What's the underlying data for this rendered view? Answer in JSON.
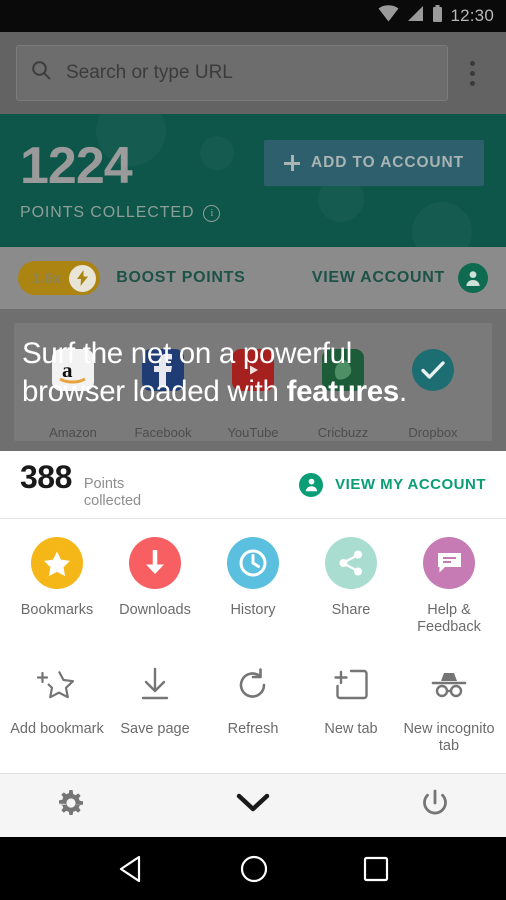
{
  "statusbar": {
    "time": "12:30",
    "icons": [
      "wifi-icon",
      "signal-icon",
      "battery-icon"
    ]
  },
  "toolbar": {
    "url_placeholder": "Search or type URL",
    "search_icon": "search-icon",
    "overflow_icon": "overflow-menu-icon"
  },
  "points_hero": {
    "points": "1224",
    "caption": "POINTS COLLECTED",
    "info_icon": "info-icon",
    "add_button": "ADD TO ACCOUNT",
    "add_icon": "plus-icon",
    "bg_color": "#0d5649",
    "button_color": "#2e5f6d"
  },
  "boost_row": {
    "multiplier": "1.6x",
    "bolt_icon": "lightning-bolt-icon",
    "label": "BOOST POINTS",
    "view_account": "VIEW ACCOUNT",
    "avatar_icon": "account-avatar-icon",
    "pill_color": "#ab8412"
  },
  "promo": {
    "line1": "Surf the net on a powerful",
    "line2_normal": "browser loaded with ",
    "line2_bold": "features",
    "line2_end": "."
  },
  "shortcuts": [
    {
      "label": "Amazon",
      "icon": "amazon-icon",
      "color": "#ffffff"
    },
    {
      "label": "Facebook",
      "icon": "facebook-icon",
      "color": "#1f3c75"
    },
    {
      "label": "YouTube",
      "icon": "youtube-icon",
      "color": "#a62020"
    },
    {
      "label": "Cricbuzz",
      "icon": "cricbuzz-icon",
      "color": "#1d5c38"
    },
    {
      "label": "Dropbox",
      "icon": "dropbox-check-icon",
      "color": "#1d6e72"
    }
  ],
  "sheet_points": {
    "number": "388",
    "caption_line1": "Points",
    "caption_line2": "collected",
    "view_account": "VIEW MY ACCOUNT",
    "avatar_icon": "account-avatar-icon",
    "accent_color": "#0a9d76"
  },
  "menu_row1": [
    {
      "label": "Bookmarks",
      "icon": "star-icon",
      "color": "#f5b618"
    },
    {
      "label": "Downloads",
      "icon": "download-arrow-icon",
      "color": "#f85f62"
    },
    {
      "label": "History",
      "icon": "clock-icon",
      "color": "#5bbfe0"
    },
    {
      "label": "Share",
      "icon": "share-icon",
      "color": "#a8ddd0"
    },
    {
      "label": "Help & Feedback",
      "icon": "chat-bubble-icon",
      "color": "#c77bb4"
    }
  ],
  "menu_row2": [
    {
      "label": "Add bookmark",
      "icon": "star-plus-icon"
    },
    {
      "label": "Save page",
      "icon": "save-download-icon"
    },
    {
      "label": "Refresh",
      "icon": "refresh-icon"
    },
    {
      "label": "New tab",
      "icon": "new-tab-icon"
    },
    {
      "label": "New incognito tab",
      "icon": "incognito-icon"
    }
  ],
  "sheet_bottom": [
    {
      "name": "settings",
      "icon": "gear-icon"
    },
    {
      "name": "collapse",
      "icon": "chevron-down-icon"
    },
    {
      "name": "exit",
      "icon": "power-icon"
    }
  ],
  "navbar": [
    {
      "name": "back",
      "icon": "back-triangle-icon"
    },
    {
      "name": "home",
      "icon": "home-circle-icon"
    },
    {
      "name": "recents",
      "icon": "recents-square-icon"
    }
  ]
}
